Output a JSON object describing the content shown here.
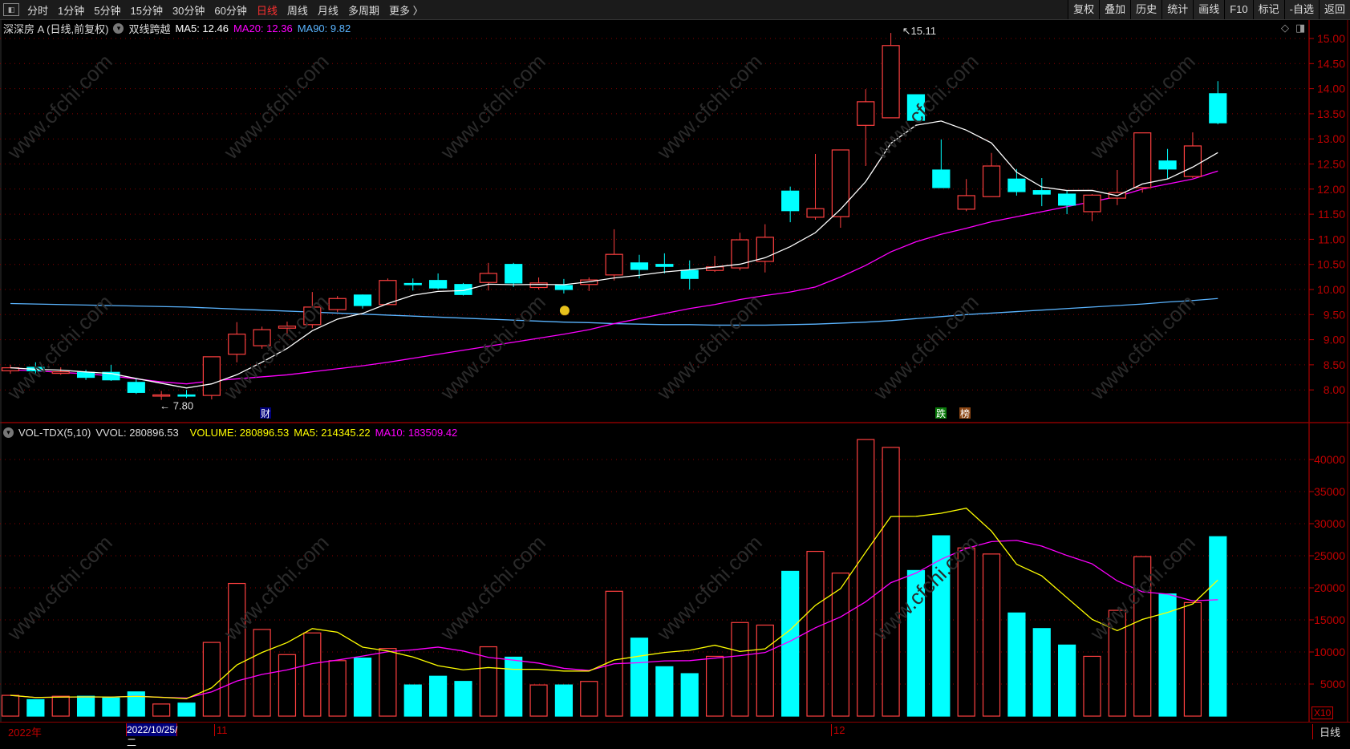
{
  "toolbar": {
    "periods": [
      "分时",
      "1分钟",
      "5分钟",
      "15分钟",
      "30分钟",
      "60分钟",
      "日线",
      "周线",
      "月线",
      "多周期",
      "更多 〉"
    ],
    "active_period": "日线",
    "buttons": [
      "复权",
      "叠加",
      "历史",
      "统计",
      "画线",
      "F10",
      "标记",
      "-自选",
      "返回"
    ]
  },
  "price_legend": {
    "title": "深深房 A (日线,前复权)",
    "indicator": "双线跨越",
    "ma5": "MA5: 12.46",
    "ma20": "MA20: 12.36",
    "ma90": "MA90: 9.82"
  },
  "volume_legend": {
    "name": "VOL-TDX(5,10)",
    "vvol": "VVOL: 280896.53",
    "volume": "VOLUME: 280896.53",
    "ma5": "MA5: 214345.22",
    "ma10": "MA10: 183509.42"
  },
  "annotations": {
    "high": "15.11",
    "low": "7.80",
    "marker_cai": "财",
    "marker_die": "跌",
    "marker_bang": "榜"
  },
  "axis": {
    "volume_multiplier": "X10",
    "period_label": "日线"
  },
  "dates": {
    "year": "2022年",
    "selected": "2022/10/25/二",
    "m11": "11",
    "m12": "12"
  },
  "colors": {
    "up": "#ff4040",
    "down": "#00ffff",
    "ma5": "#ffffff",
    "ma20": "#ff00ff",
    "ma90": "#5ab4ff",
    "vma5": "#ffff00",
    "vma10": "#ff00ff",
    "axis": "#c00000"
  },
  "chart_data": [
    {
      "type": "candlestick",
      "title": "深深房 A (日线,前复权)",
      "ylim": [
        7.7,
        15.2
      ],
      "yticks": [
        "8.00",
        "8.50",
        "9.00",
        "9.50",
        "10.00",
        "10.50",
        "11.00",
        "11.50",
        "12.00",
        "12.50",
        "13.00",
        "13.50",
        "14.00",
        "14.50",
        "15.00"
      ],
      "ohlc": [
        [
          8.38,
          8.5,
          8.32,
          8.44
        ],
        [
          8.45,
          8.55,
          8.33,
          8.38
        ],
        [
          8.33,
          8.45,
          8.3,
          8.36
        ],
        [
          8.35,
          8.4,
          8.2,
          8.25
        ],
        [
          8.35,
          8.5,
          8.18,
          8.2
        ],
        [
          8.15,
          8.22,
          7.92,
          7.95
        ],
        [
          7.88,
          7.98,
          7.8,
          7.9
        ],
        [
          7.9,
          8.0,
          7.84,
          7.89
        ],
        [
          7.89,
          8.66,
          7.81,
          8.66
        ],
        [
          8.71,
          9.35,
          8.55,
          9.11
        ],
        [
          8.88,
          9.26,
          8.82,
          9.2
        ],
        [
          9.23,
          9.36,
          9.07,
          9.27
        ],
        [
          9.3,
          9.95,
          9.23,
          9.65
        ],
        [
          9.6,
          9.87,
          9.55,
          9.82
        ],
        [
          9.89,
          9.9,
          9.62,
          9.68
        ],
        [
          9.7,
          10.22,
          9.7,
          10.18
        ],
        [
          10.12,
          10.22,
          9.98,
          10.1
        ],
        [
          10.18,
          10.32,
          10.0,
          10.03
        ],
        [
          10.1,
          10.13,
          9.88,
          9.9
        ],
        [
          10.14,
          10.53,
          9.98,
          10.32
        ],
        [
          10.5,
          10.53,
          10.05,
          10.13
        ],
        [
          10.04,
          10.24,
          10.0,
          10.13
        ],
        [
          10.08,
          10.21,
          9.92,
          10.0
        ],
        [
          10.1,
          10.24,
          9.97,
          10.19
        ],
        [
          10.29,
          11.2,
          10.18,
          10.7
        ],
        [
          10.53,
          10.69,
          10.22,
          10.4
        ],
        [
          10.5,
          10.72,
          10.32,
          10.46
        ],
        [
          10.38,
          10.58,
          10.0,
          10.22
        ],
        [
          10.38,
          10.67,
          10.35,
          10.45
        ],
        [
          10.43,
          11.13,
          10.38,
          10.99
        ],
        [
          10.56,
          11.3,
          10.34,
          11.04
        ],
        [
          11.96,
          12.05,
          11.34,
          11.57
        ],
        [
          11.44,
          12.7,
          11.39,
          11.61
        ],
        [
          11.45,
          12.78,
          11.23,
          12.78
        ],
        [
          13.27,
          13.99,
          12.46,
          13.74
        ],
        [
          13.42,
          15.11,
          13.42,
          14.86
        ],
        [
          13.88,
          13.88,
          13.37,
          13.37
        ],
        [
          12.38,
          12.99,
          12.03,
          12.03
        ],
        [
          11.6,
          12.2,
          11.56,
          11.87
        ],
        [
          11.85,
          12.72,
          11.85,
          12.46
        ],
        [
          12.2,
          12.4,
          11.87,
          11.95
        ],
        [
          11.97,
          12.22,
          11.66,
          11.9
        ],
        [
          11.9,
          11.98,
          11.5,
          11.68
        ],
        [
          11.55,
          11.9,
          11.36,
          11.88
        ],
        [
          11.82,
          12.38,
          11.68,
          11.93
        ],
        [
          12.03,
          13.12,
          11.93,
          13.12
        ],
        [
          12.56,
          12.8,
          12.2,
          12.4
        ],
        [
          12.25,
          13.13,
          12.22,
          12.86
        ],
        [
          13.9,
          14.15,
          13.29,
          13.32
        ]
      ],
      "ma20": [
        8.4,
        8.38,
        8.35,
        8.32,
        8.28,
        8.22,
        8.16,
        8.12,
        8.18,
        8.22,
        8.26,
        8.3,
        8.36,
        8.42,
        8.48,
        8.55,
        8.63,
        8.71,
        8.79,
        8.87,
        8.95,
        9.03,
        9.11,
        9.2,
        9.32,
        9.42,
        9.52,
        9.62,
        9.7,
        9.8,
        9.88,
        9.95,
        10.05,
        10.25,
        10.48,
        10.75,
        10.95,
        11.1,
        11.22,
        11.35,
        11.45,
        11.55,
        11.65,
        11.75,
        11.85,
        12.0,
        12.1,
        12.2,
        12.36
      ],
      "ma90": [
        9.72,
        9.71,
        9.7,
        9.69,
        9.68,
        9.67,
        9.66,
        9.65,
        9.63,
        9.61,
        9.59,
        9.57,
        9.55,
        9.53,
        9.51,
        9.49,
        9.47,
        9.45,
        9.43,
        9.41,
        9.39,
        9.37,
        9.35,
        9.34,
        9.32,
        9.31,
        9.3,
        9.3,
        9.29,
        9.29,
        9.29,
        9.3,
        9.31,
        9.33,
        9.35,
        9.38,
        9.42,
        9.46,
        9.5,
        9.53,
        9.56,
        9.59,
        9.62,
        9.65,
        9.68,
        9.71,
        9.75,
        9.78,
        9.82
      ]
    },
    {
      "type": "bar",
      "title": "VOL-TDX(5,10)",
      "ylim": [
        0,
        45000
      ],
      "yticks": [
        "5000",
        "10000",
        "15000",
        "20000",
        "25000",
        "30000",
        "35000",
        "40000"
      ],
      "values": [
        3240,
        2570,
        3100,
        3100,
        2840,
        3780,
        1890,
        2030,
        11490,
        20680,
        13510,
        9590,
        12970,
        8650,
        9050,
        10540,
        4860,
        6220,
        5410,
        10810,
        9190,
        4860,
        4860,
        5410,
        19460,
        12160,
        7700,
        6620,
        9320,
        14590,
        14190,
        22570,
        25680,
        22300,
        43110,
        41890,
        22700,
        28110,
        26220,
        25270,
        16080,
        13650,
        11080,
        9320,
        16490,
        24860,
        19050,
        17700,
        27970
      ]
    }
  ]
}
